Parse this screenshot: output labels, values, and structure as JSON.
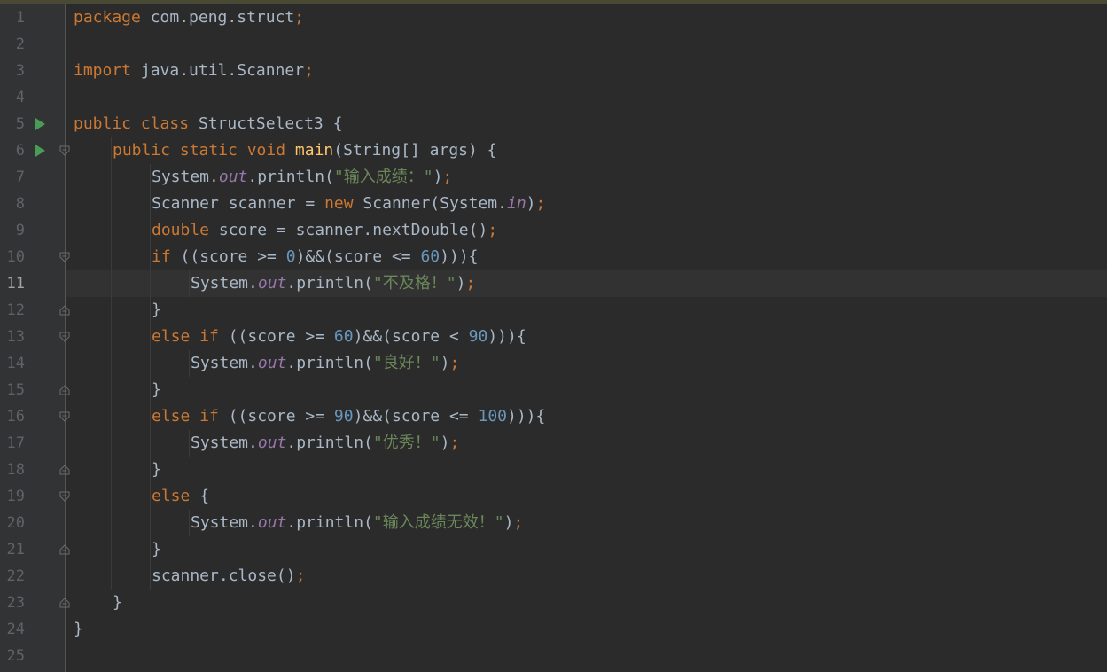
{
  "editor": {
    "language": "java",
    "current_line": 11,
    "colors": {
      "background": "#2b2b2b",
      "gutter": "#313335",
      "keyword": "#cc7832",
      "method_decl": "#ffc66d",
      "static_field": "#9876aa",
      "number": "#6897bb",
      "string": "#6a8759",
      "default_text": "#a9b7c6",
      "line_number": "#606366",
      "run_icon": "#499c54"
    },
    "lines": [
      {
        "n": "1",
        "indent": 0,
        "tokens": [
          [
            "kw",
            "package"
          ],
          [
            "plain",
            " com.peng.struct"
          ],
          [
            "semi",
            ";"
          ]
        ]
      },
      {
        "n": "2",
        "indent": 0,
        "tokens": []
      },
      {
        "n": "3",
        "indent": 0,
        "tokens": [
          [
            "kw",
            "import"
          ],
          [
            "plain",
            " java.util.Scanner"
          ],
          [
            "semi",
            ";"
          ]
        ]
      },
      {
        "n": "4",
        "indent": 0,
        "tokens": []
      },
      {
        "n": "5",
        "indent": 0,
        "run": true,
        "tokens": [
          [
            "kw",
            "public class"
          ],
          [
            "plain",
            " StructSelect3 {"
          ]
        ]
      },
      {
        "n": "6",
        "indent": 1,
        "run": true,
        "fold": "open",
        "tokens": [
          [
            "kw",
            "public static void"
          ],
          [
            "plain",
            " "
          ],
          [
            "fn",
            "main"
          ],
          [
            "plain",
            "(String[] args) {"
          ]
        ]
      },
      {
        "n": "7",
        "indent": 2,
        "tokens": [
          [
            "plain",
            "System."
          ],
          [
            "fld",
            "out"
          ],
          [
            "plain",
            ".println("
          ],
          [
            "str",
            "\"输入成绩：\""
          ],
          [
            "plain",
            ")"
          ],
          [
            "semi",
            ";"
          ]
        ]
      },
      {
        "n": "8",
        "indent": 2,
        "tokens": [
          [
            "plain",
            "Scanner scanner = "
          ],
          [
            "kw",
            "new"
          ],
          [
            "plain",
            " Scanner(System."
          ],
          [
            "fld",
            "in"
          ],
          [
            "plain",
            ")"
          ],
          [
            "semi",
            ";"
          ]
        ]
      },
      {
        "n": "9",
        "indent": 2,
        "tokens": [
          [
            "kw",
            "double"
          ],
          [
            "plain",
            " score = scanner.nextDouble()"
          ],
          [
            "semi",
            ";"
          ]
        ]
      },
      {
        "n": "10",
        "indent": 2,
        "fold": "open",
        "tokens": [
          [
            "kw",
            "if"
          ],
          [
            "plain",
            " ((score >= "
          ],
          [
            "num",
            "0"
          ],
          [
            "plain",
            ")&&(score <= "
          ],
          [
            "num",
            "60"
          ],
          [
            "plain",
            "))){"
          ]
        ]
      },
      {
        "n": "11",
        "indent": 3,
        "tokens": [
          [
            "plain",
            "System."
          ],
          [
            "fld",
            "out"
          ],
          [
            "plain",
            ".println("
          ],
          [
            "str",
            "\"不及格！\""
          ],
          [
            "plain",
            ")"
          ],
          [
            "semi",
            ";"
          ]
        ]
      },
      {
        "n": "12",
        "indent": 2,
        "fold": "close",
        "tokens": [
          [
            "plain",
            "}"
          ]
        ]
      },
      {
        "n": "13",
        "indent": 2,
        "fold": "open",
        "tokens": [
          [
            "kw",
            "else if"
          ],
          [
            "plain",
            " ((score >= "
          ],
          [
            "num",
            "60"
          ],
          [
            "plain",
            ")&&(score < "
          ],
          [
            "num",
            "90"
          ],
          [
            "plain",
            "))){"
          ]
        ]
      },
      {
        "n": "14",
        "indent": 3,
        "tokens": [
          [
            "plain",
            "System."
          ],
          [
            "fld",
            "out"
          ],
          [
            "plain",
            ".println("
          ],
          [
            "str",
            "\"良好！\""
          ],
          [
            "plain",
            ")"
          ],
          [
            "semi",
            ";"
          ]
        ]
      },
      {
        "n": "15",
        "indent": 2,
        "fold": "close",
        "tokens": [
          [
            "plain",
            "}"
          ]
        ]
      },
      {
        "n": "16",
        "indent": 2,
        "fold": "open",
        "tokens": [
          [
            "kw",
            "else if"
          ],
          [
            "plain",
            " ((score >= "
          ],
          [
            "num",
            "90"
          ],
          [
            "plain",
            ")&&(score <= "
          ],
          [
            "num",
            "100"
          ],
          [
            "plain",
            "))){"
          ]
        ]
      },
      {
        "n": "17",
        "indent": 3,
        "tokens": [
          [
            "plain",
            "System."
          ],
          [
            "fld",
            "out"
          ],
          [
            "plain",
            ".println("
          ],
          [
            "str",
            "\"优秀！\""
          ],
          [
            "plain",
            ")"
          ],
          [
            "semi",
            ";"
          ]
        ]
      },
      {
        "n": "18",
        "indent": 2,
        "fold": "close",
        "tokens": [
          [
            "plain",
            "}"
          ]
        ]
      },
      {
        "n": "19",
        "indent": 2,
        "fold": "open",
        "tokens": [
          [
            "kw",
            "else"
          ],
          [
            "plain",
            " {"
          ]
        ]
      },
      {
        "n": "20",
        "indent": 3,
        "tokens": [
          [
            "plain",
            "System."
          ],
          [
            "fld",
            "out"
          ],
          [
            "plain",
            ".println("
          ],
          [
            "str",
            "\"输入成绩无效！\""
          ],
          [
            "plain",
            ")"
          ],
          [
            "semi",
            ";"
          ]
        ]
      },
      {
        "n": "21",
        "indent": 2,
        "fold": "close",
        "tokens": [
          [
            "plain",
            "}"
          ]
        ]
      },
      {
        "n": "22",
        "indent": 2,
        "tokens": [
          [
            "plain",
            "scanner.close()"
          ],
          [
            "semi",
            ";"
          ]
        ]
      },
      {
        "n": "23",
        "indent": 1,
        "fold": "close",
        "tokens": [
          [
            "plain",
            "}"
          ]
        ]
      },
      {
        "n": "24",
        "indent": 0,
        "tokens": [
          [
            "plain",
            "}"
          ]
        ]
      },
      {
        "n": "25",
        "indent": 0,
        "tokens": []
      }
    ],
    "icons": {
      "run": "run-gutter-icon",
      "fold_open": "fold-collapse-icon",
      "fold_close": "fold-end-icon"
    }
  }
}
